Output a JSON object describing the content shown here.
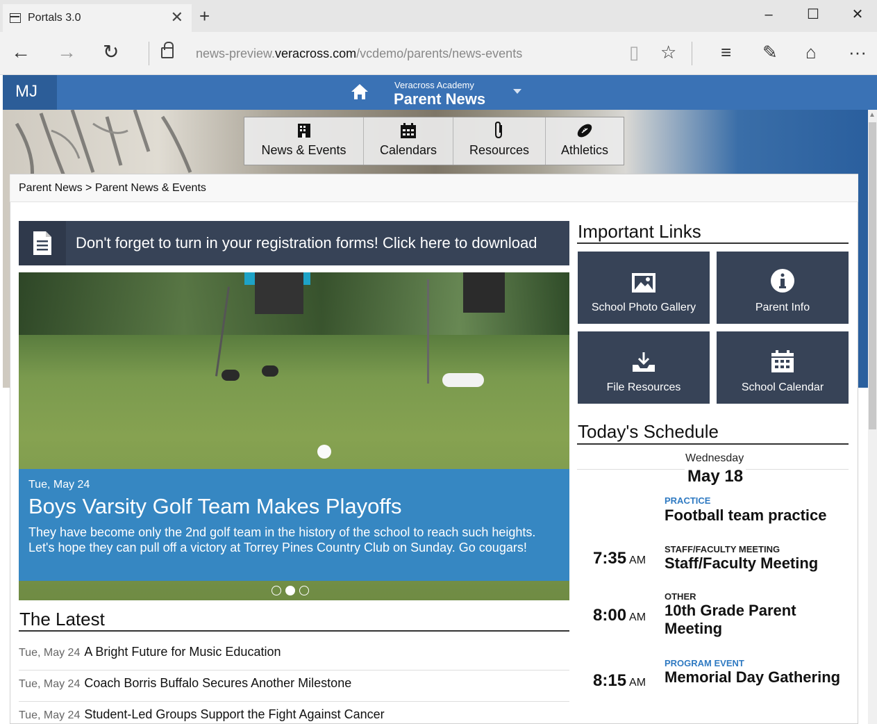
{
  "browser": {
    "tab_title": "Portals 3.0",
    "url_prefix": "news-preview.",
    "url_domain": "veracross.com",
    "url_path": "/vcdemo/parents/news-events"
  },
  "header": {
    "initials": "MJ",
    "school_name": "Veracross Academy",
    "portal_name": "Parent News"
  },
  "nav": [
    {
      "label": "News & Events",
      "icon": "building-icon"
    },
    {
      "label": "Calendars",
      "icon": "calendar-icon"
    },
    {
      "label": "Resources",
      "icon": "paperclip-icon"
    },
    {
      "label": "Athletics",
      "icon": "football-icon"
    }
  ],
  "breadcrumb": "Parent News > Parent News & Events",
  "alert": {
    "text": "Don't forget to turn in your registration forms! Click here to download",
    "icon": "document-icon"
  },
  "slide": {
    "date": "Tue, May 24",
    "title": "Boys Varsity Golf Team Makes Playoffs",
    "text": "They have become only the 2nd golf team in the history of the school to reach such heights. Let's hope they can pull off a victory at Torrey Pines Country Club on Sunday. Go cougars!",
    "dots": 3,
    "active_dot": 2
  },
  "latest": {
    "title": "The Latest",
    "items": [
      {
        "date": "Tue, May 24",
        "title": "A Bright Future for Music Education"
      },
      {
        "date": "Tue, May 24",
        "title": "Coach Borris Buffalo Secures Another Milestone"
      },
      {
        "date": "Tue, May 24",
        "title": "Student-Led Groups Support the Fight Against Cancer"
      }
    ]
  },
  "important_links": {
    "title": "Important Links",
    "tiles": [
      {
        "label": "School Photo Gallery",
        "icon": "photo-icon"
      },
      {
        "label": "Parent Info",
        "icon": "info-icon"
      },
      {
        "label": "File Resources",
        "icon": "download-tray-icon"
      },
      {
        "label": "School Calendar",
        "icon": "calendar-icon"
      }
    ]
  },
  "schedule": {
    "title": "Today's Schedule",
    "day_name": "Wednesday",
    "day_date": "May 18",
    "events": [
      {
        "time": "",
        "ampm": "",
        "category": "PRACTICE",
        "category_color": "#2f7ac2",
        "title": "Football team practice"
      },
      {
        "time": "7:35",
        "ampm": "AM",
        "category": "STAFF/FACULTY MEETING",
        "category_color": "#222222",
        "title": "Staff/Faculty Meeting"
      },
      {
        "time": "8:00",
        "ampm": "AM",
        "category": "OTHER",
        "category_color": "#222222",
        "title": "10th Grade Parent Meeting"
      },
      {
        "time": "8:15",
        "ampm": "AM",
        "category": "PROGRAM EVENT",
        "category_color": "#2f7ac2",
        "title": "Memorial Day Gathering"
      }
    ]
  },
  "colors": {
    "header_blue": "#3a72b5",
    "tile_navy": "#374357",
    "caption_blue": "#3687c2"
  }
}
